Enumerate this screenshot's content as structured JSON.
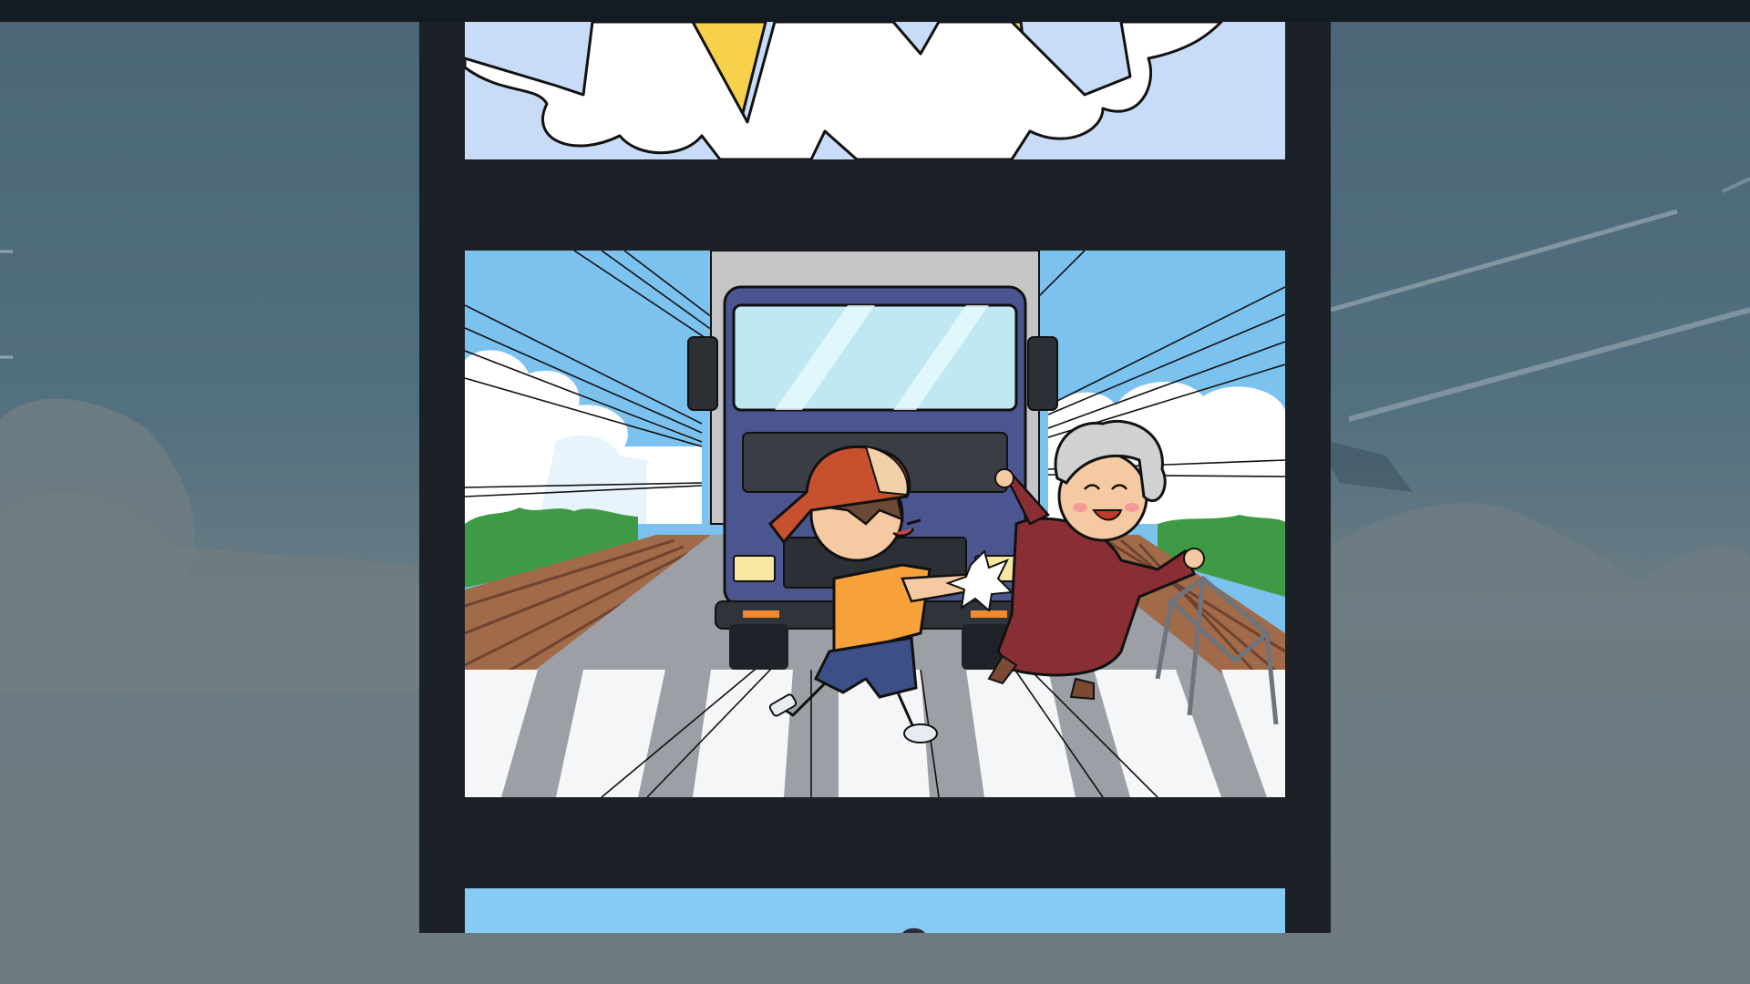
{
  "scene": {
    "description_colors": {
      "backdrop_sky": "#4a6677",
      "strip_frame": "#1c2127",
      "top_bar": "#151b23",
      "panel_sky": "#7cc2ef",
      "truck_cab": "#4b5690",
      "boy_shirt": "#f7a13a",
      "boy_cap": "#c7502f",
      "grandma_dress": "#8a2e35",
      "crosswalk": "#f4f6f8"
    },
    "panels": [
      {
        "id": "panel-top",
        "content": "sunburst-cloud"
      },
      {
        "id": "panel-main",
        "content": "boy-pushes-grandma-from-truck"
      },
      {
        "id": "panel-next",
        "content": "sky"
      }
    ]
  }
}
